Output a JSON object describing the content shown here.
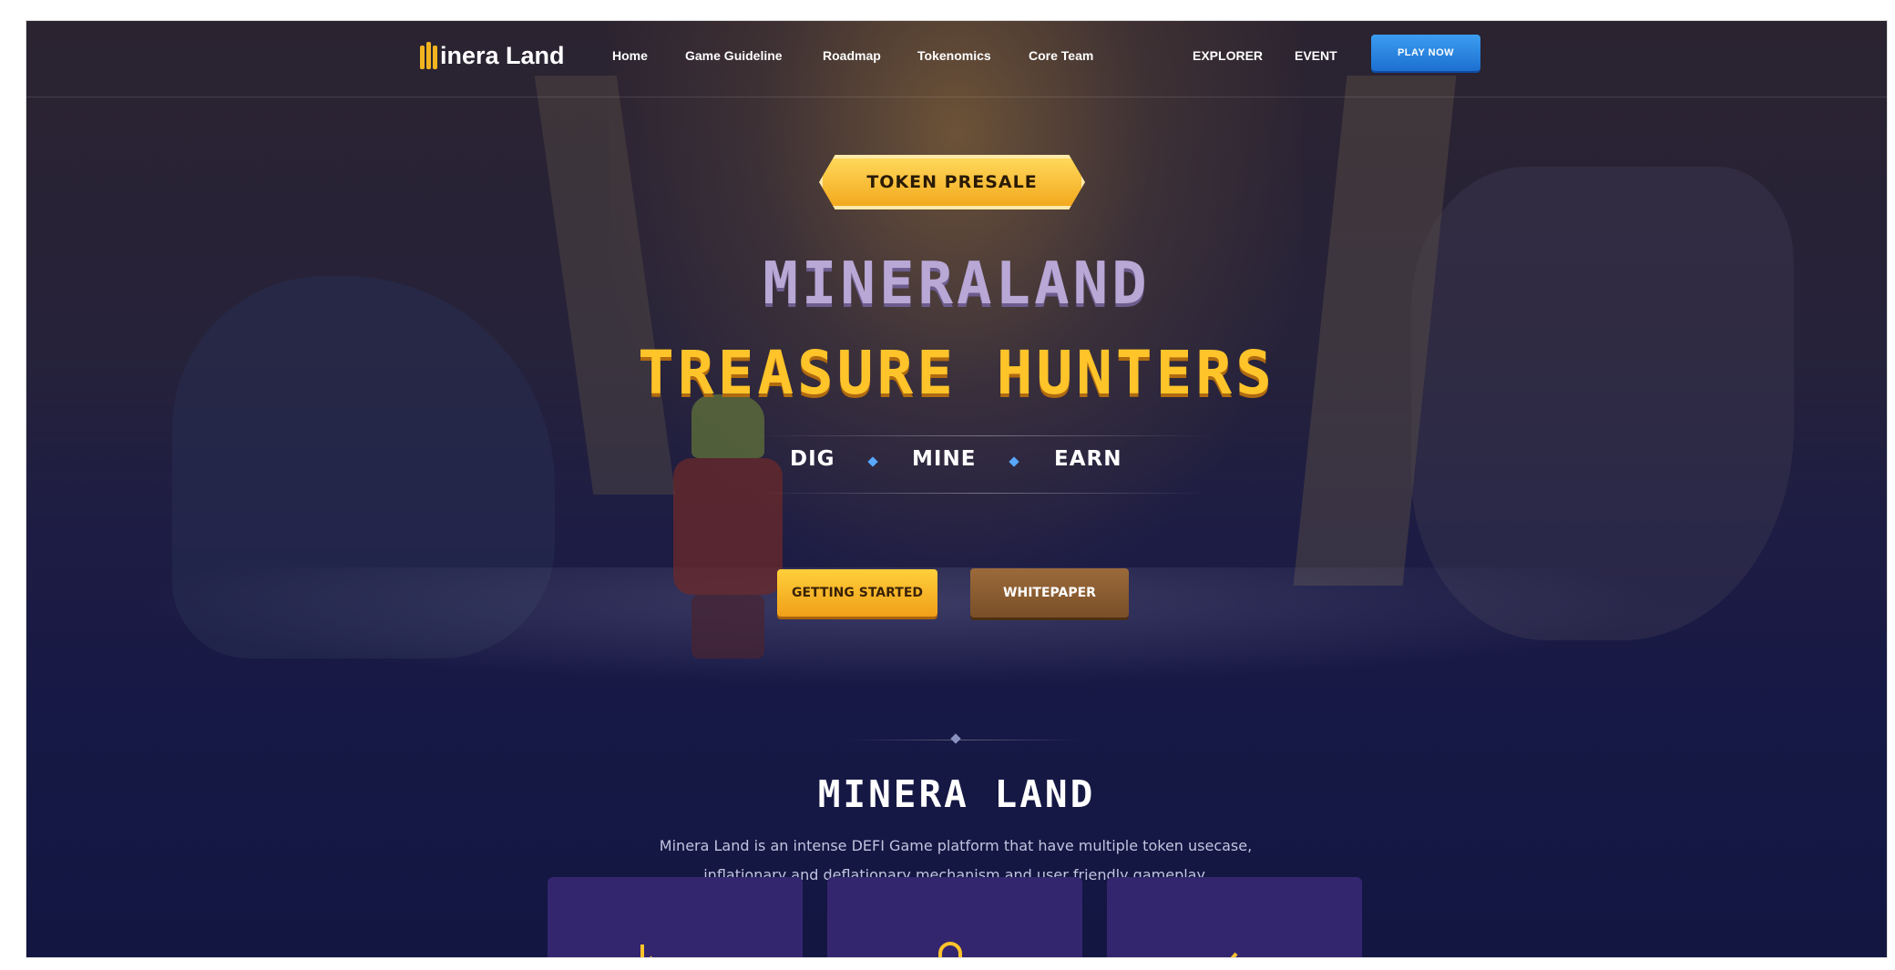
{
  "nav": {
    "logo_text": "inera Land",
    "links": [
      "Home",
      "Game Guideline",
      "Roadmap",
      "Tokenomics",
      "Core Team"
    ],
    "right_links": [
      "EXPLORER",
      "EVENT"
    ],
    "play_button": "PLAY NOW"
  },
  "hero": {
    "badge": "TOKEN PRESALE",
    "title_line1": "MINERALAND",
    "title_line2": "TREASURE HUNTERS",
    "tagline": [
      "DIG",
      "MINE",
      "EARN"
    ],
    "primary_button": "GETTING STARTED",
    "secondary_button": "WHITEPAPER"
  },
  "about": {
    "title": "MINERA LAND",
    "description_line1": "Minera Land is an intense DEFI Game platform that have multiple token usecase,",
    "description_line2": "inflationary and deflationary mechanism and user friendly gameplay.",
    "cards": [
      {
        "icon": "chart-down-icon"
      },
      {
        "icon": "shopping-bag-icon"
      },
      {
        "icon": "robot-icon"
      }
    ]
  },
  "colors": {
    "accent_gold": "#ffc42a",
    "play_blue": "#1d6fd0",
    "card_purple": "#34266e",
    "bg_navy": "#161845"
  }
}
